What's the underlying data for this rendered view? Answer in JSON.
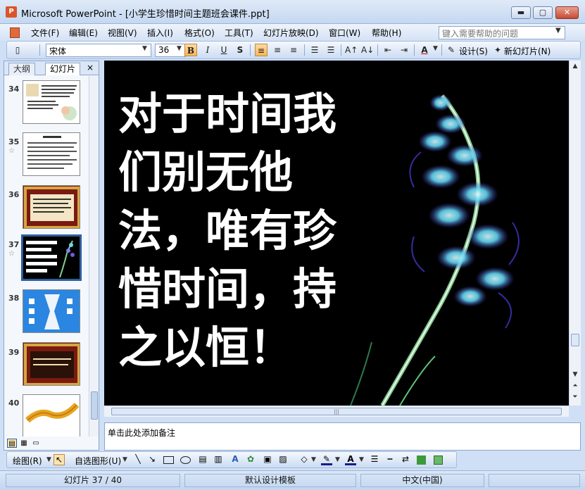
{
  "window": {
    "app_title": "Microsoft PowerPoint - [小学生珍惜时间主题班会课件.ppt]",
    "minimize": "▬",
    "maximize": "▢",
    "close": "✕"
  },
  "menu": {
    "items": [
      "文件(F)",
      "编辑(E)",
      "视图(V)",
      "插入(I)",
      "格式(O)",
      "工具(T)",
      "幻灯片放映(D)",
      "窗口(W)",
      "帮助(H)"
    ],
    "help_placeholder": "键入需要帮助的问题"
  },
  "toolbar": {
    "font_name": "宋体",
    "font_size": "36",
    "bold": "B",
    "italic": "I",
    "underline": "U",
    "shadow": "S",
    "design_label": "设计(S)",
    "new_slide_label": "新幻灯片(N)"
  },
  "left_panel": {
    "tabs": [
      "大纲",
      "幻灯片"
    ],
    "close": "×",
    "thumbnails": [
      {
        "number": "34",
        "starred": false
      },
      {
        "number": "35",
        "starred": true
      },
      {
        "number": "36",
        "starred": false
      },
      {
        "number": "37",
        "starred": true,
        "selected": true
      },
      {
        "number": "38",
        "starred": false
      },
      {
        "number": "39",
        "starred": false
      },
      {
        "number": "40",
        "starred": false
      }
    ]
  },
  "slide": {
    "lines": [
      "对于时间我",
      "们别无他",
      "法，唯有珍",
      "惜时间，持",
      "之以恒！"
    ]
  },
  "notes": {
    "placeholder": "单击此处添加备注"
  },
  "drawing_toolbar": {
    "draw_label": "绘图(R)",
    "autoshape_label": "自选图形(U)"
  },
  "status": {
    "slide_position": "幻灯片 37 / 40",
    "template": "默认设计模板",
    "language": "中文(中国)"
  }
}
